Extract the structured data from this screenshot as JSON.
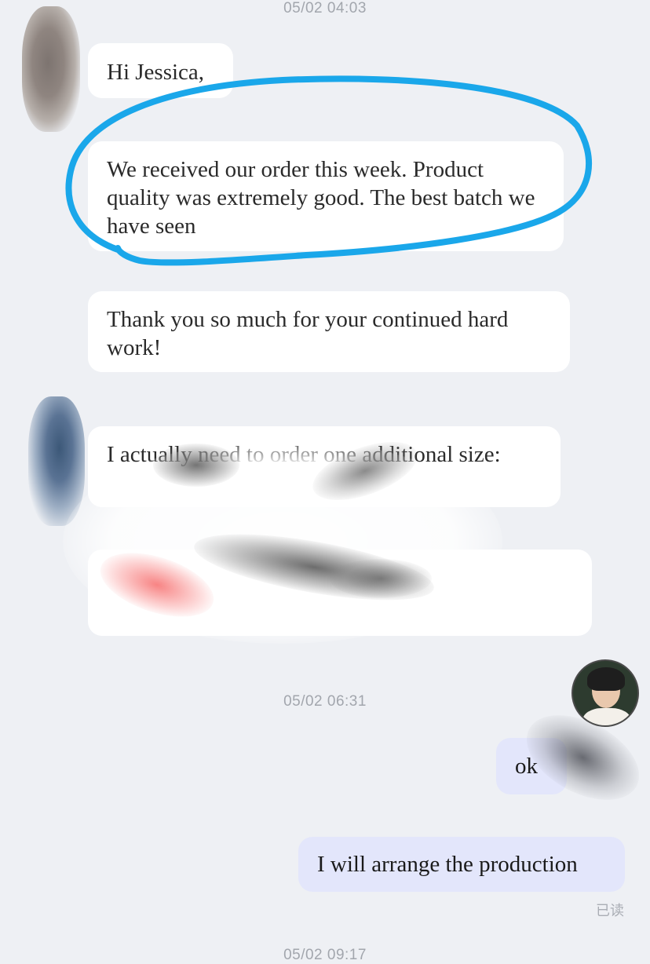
{
  "timestamps": {
    "first": "05/02 04:03",
    "second": "05/02 06:31",
    "third_partial": "05/02 09:17"
  },
  "incoming_messages": [
    {
      "text": "Hi Jessica,"
    },
    {
      "text": "We received our order this week. Product quality was extremely good. The best batch we have seen"
    },
    {
      "text": "Thank you so much for your continued hard work!"
    },
    {
      "text": "I actually need to order one additional size:"
    }
  ],
  "outgoing_messages": [
    {
      "text": "ok"
    },
    {
      "text": "I will arrange the production"
    }
  ],
  "read_receipt": "已读",
  "colors": {
    "background": "#eef0f4",
    "incoming_bubble": "#ffffff",
    "outgoing_bubble": "#e3e6fb",
    "highlight_annotation": "#1aa7ea"
  },
  "icons": {
    "sender_avatar": "avatar-photo-blurred",
    "user_avatar": "avatar-photo-woman"
  }
}
